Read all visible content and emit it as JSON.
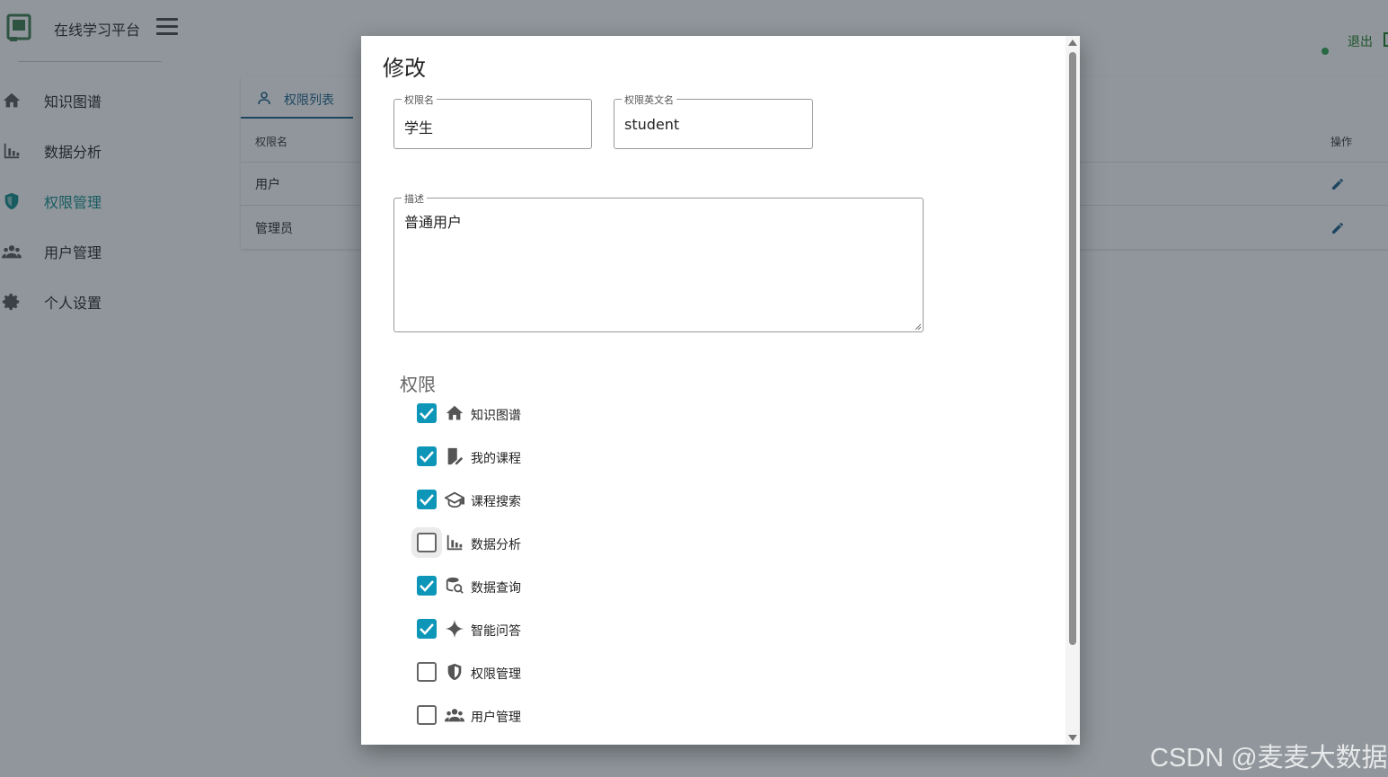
{
  "app": {
    "title": "在线学习平台"
  },
  "sidebar": {
    "items": [
      {
        "label": "知识图谱",
        "icon": "home-icon"
      },
      {
        "label": "数据分析",
        "icon": "bar-chart-icon"
      },
      {
        "label": "权限管理",
        "icon": "shield-icon",
        "active": true
      },
      {
        "label": "用户管理",
        "icon": "users-icon"
      },
      {
        "label": "个人设置",
        "icon": "gear-icon"
      }
    ]
  },
  "header": {
    "logout_label": "退出"
  },
  "permission_list": {
    "tab_label": "权限列表",
    "columns": {
      "name": "权限名",
      "actions": "操作"
    },
    "rows": [
      {
        "name": "用户"
      },
      {
        "name": "管理员"
      }
    ]
  },
  "dialog": {
    "title": "修改",
    "name_field": {
      "label": "权限名",
      "value": "学生"
    },
    "english_name_field": {
      "label": "权限英文名",
      "value": "student"
    },
    "description_field": {
      "label": "描述",
      "value": "普通用户"
    },
    "permissions_section_title": "权限",
    "permissions": [
      {
        "label": "知识图谱",
        "icon": "home-icon",
        "checked": true
      },
      {
        "label": "我的课程",
        "icon": "book-edit-icon",
        "checked": true
      },
      {
        "label": "课程搜索",
        "icon": "graduation-cap-icon",
        "checked": true
      },
      {
        "label": "数据分析",
        "icon": "bar-chart-icon",
        "checked": false
      },
      {
        "label": "数据查询",
        "icon": "database-search-icon",
        "checked": true
      },
      {
        "label": "智能问答",
        "icon": "sparkle-icon",
        "checked": true
      },
      {
        "label": "权限管理",
        "icon": "shield-icon",
        "checked": false
      },
      {
        "label": "用户管理",
        "icon": "users-icon",
        "checked": false
      }
    ]
  },
  "watermark": "CSDN @麦麦大数据",
  "colors": {
    "accent": "#0d96b7",
    "active_nav": "#0f8a8a",
    "tab_blue": "#1a5f8a",
    "overlay": "rgba(33,45,55,0.5)"
  }
}
